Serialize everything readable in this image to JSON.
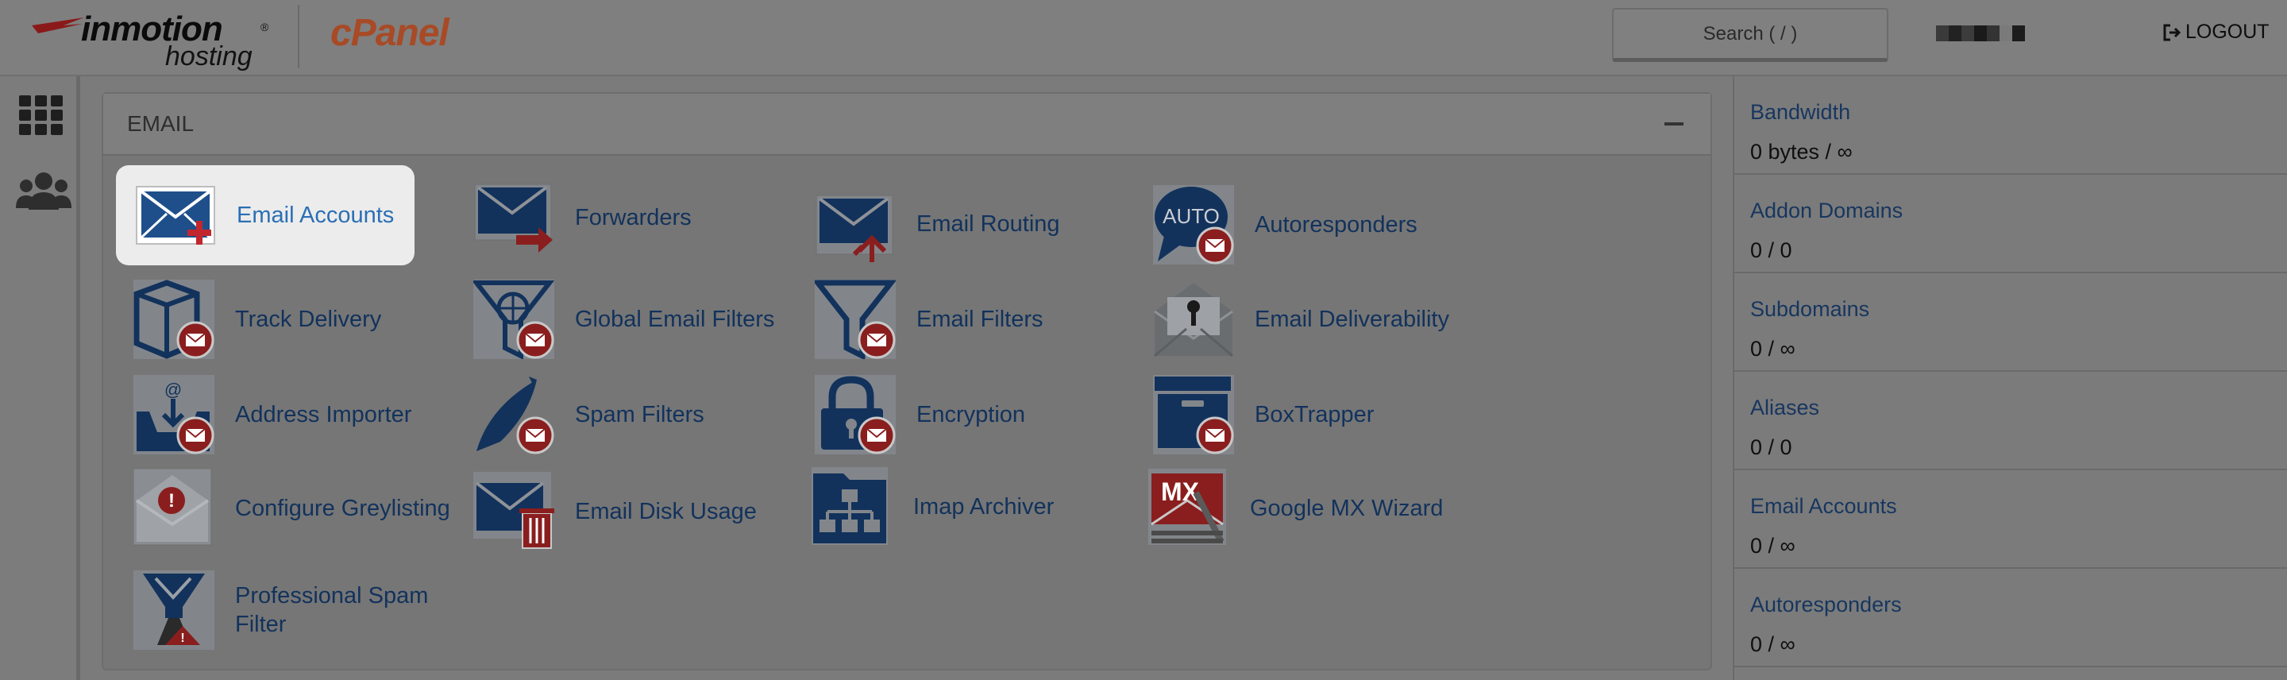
{
  "header": {
    "brand_top": "inmotion",
    "brand_reg": "®",
    "brand_sub": "hosting",
    "cpanel": "cPanel",
    "search_placeholder": "Search ( / )",
    "logout_label": "LOGOUT"
  },
  "sidebar": {
    "items": [
      {
        "icon": "grid-icon"
      },
      {
        "icon": "users-icon"
      }
    ]
  },
  "email_section": {
    "title": "EMAIL",
    "tools": [
      {
        "label": "Email Accounts",
        "icon": "email-accounts-icon"
      },
      {
        "label": "Forwarders",
        "icon": "forwarders-icon"
      },
      {
        "label": "Email Routing",
        "icon": "email-routing-icon"
      },
      {
        "label": "Autoresponders",
        "icon": "autoresponders-icon",
        "badge": "AUTO"
      },
      {
        "label": "Track Delivery",
        "icon": "track-delivery-icon"
      },
      {
        "label": "Global Email Filters",
        "icon": "global-filters-icon"
      },
      {
        "label": "Email Filters",
        "icon": "email-filters-icon"
      },
      {
        "label": "Email Deliverability",
        "icon": "deliverability-icon"
      },
      {
        "label": "Address Importer",
        "icon": "address-importer-icon",
        "badge": "@"
      },
      {
        "label": "Spam Filters",
        "icon": "spam-filters-icon"
      },
      {
        "label": "Encryption",
        "icon": "encryption-icon"
      },
      {
        "label": "BoxTrapper",
        "icon": "boxtrapper-icon"
      },
      {
        "label": "Configure Greylisting",
        "icon": "greylisting-icon",
        "badge": "!"
      },
      {
        "label": "Email Disk Usage",
        "icon": "disk-usage-icon"
      },
      {
        "label": "Imap Archiver",
        "icon": "imap-archiver-icon"
      },
      {
        "label": "Google MX Wizard",
        "icon": "google-mx-icon",
        "badge": "MX"
      },
      {
        "label_line1": "Professional Spam",
        "label_line2": "Filter",
        "icon": "pro-spam-filter-icon"
      }
    ]
  },
  "stats": [
    {
      "label": "Bandwidth",
      "value": "0 bytes / ∞"
    },
    {
      "label": "Addon Domains",
      "value": "0 / 0"
    },
    {
      "label": "Subdomains",
      "value": "0 / ∞"
    },
    {
      "label": "Aliases",
      "value": "0 / 0"
    },
    {
      "label": "Email Accounts",
      "value": "0 / ∞"
    },
    {
      "label": "Autoresponders",
      "value": "0 / ∞"
    }
  ],
  "colors": {
    "accent_blue": "#2b6fb5",
    "icon_navy": "#12325c",
    "badge_red": "#8a1e1e",
    "cpanel_orange": "#a84a26"
  }
}
